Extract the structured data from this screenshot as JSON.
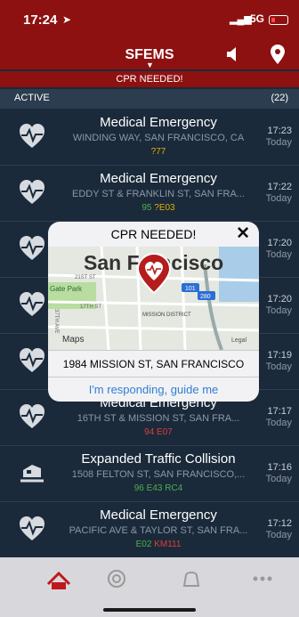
{
  "status": {
    "time": "17:24",
    "network": "5G"
  },
  "header": {
    "title": "SFEMS"
  },
  "banner": {
    "text": "CPR NEEDED!"
  },
  "active": {
    "label": "ACTIVE",
    "count": "(22)"
  },
  "incidents": [
    {
      "title": "Medical Emergency",
      "address": "WINDING WAY, SAN FRANCISCO, CA",
      "units": [
        {
          "text": "?77",
          "color": "yellow"
        }
      ],
      "time": "17:23",
      "day": "Today",
      "icon": "heartbeat-icon"
    },
    {
      "title": "Medical Emergency",
      "address": "EDDY ST & FRANKLIN ST, SAN FRA...",
      "units": [
        {
          "text": "95",
          "color": "green"
        },
        {
          "text": "?E03",
          "color": "yellow"
        }
      ],
      "time": "17:22",
      "day": "Today",
      "icon": "heartbeat-icon"
    },
    {
      "title": "",
      "address": "",
      "units": [],
      "time": "17:20",
      "day": "Today",
      "icon": "heartbeat-icon"
    },
    {
      "title": "",
      "address": "",
      "units": [],
      "time": "17:20",
      "day": "Today",
      "icon": "heartbeat-icon"
    },
    {
      "title": "",
      "address": "",
      "units": [],
      "time": "17:19",
      "day": "Today",
      "icon": "heartbeat-icon"
    },
    {
      "title": "Medical Emergency",
      "address": "16TH ST & MISSION ST, SAN FRA...",
      "units": [
        {
          "text": "94",
          "color": "red"
        },
        {
          "text": "E07",
          "color": "red"
        }
      ],
      "time": "17:17",
      "day": "Today",
      "icon": "heartbeat-icon"
    },
    {
      "title": "Expanded Traffic Collision",
      "address": "1508 FELTON ST, SAN FRANCISCO,...",
      "units": [
        {
          "text": "96",
          "color": "green"
        },
        {
          "text": "E43",
          "color": "green"
        },
        {
          "text": "RC4",
          "color": "green"
        }
      ],
      "time": "17:16",
      "day": "Today",
      "icon": "car-crash-icon"
    },
    {
      "title": "Medical Emergency",
      "address": "PACIFIC AVE & TAYLOR ST, SAN FRA...",
      "units": [
        {
          "text": "E02",
          "color": "green"
        },
        {
          "text": "KM111",
          "color": "red"
        }
      ],
      "time": "17:12",
      "day": "Today",
      "icon": "heartbeat-icon"
    }
  ],
  "popup": {
    "title": "CPR NEEDED!",
    "map_city": "San Francisco",
    "map_labels": {
      "gate_park": "Gate Park",
      "st1": "21ST ST",
      "st2": "17TH ST",
      "ave": "37TH AVE",
      "mission": "MISSION DISTRICT",
      "hw101": "101",
      "hw280": "280",
      "maps": "Maps",
      "legal": "Legal"
    },
    "address": "1984 MISSION ST, SAN FRANCISCO",
    "respond": "I'm responding, guide me"
  },
  "colors": {
    "header": "#8e1111",
    "background": "#1b2a3a",
    "link": "#2f7fd4",
    "green": "#4caf50",
    "yellow": "#e0b000",
    "red": "#e03c3c"
  }
}
